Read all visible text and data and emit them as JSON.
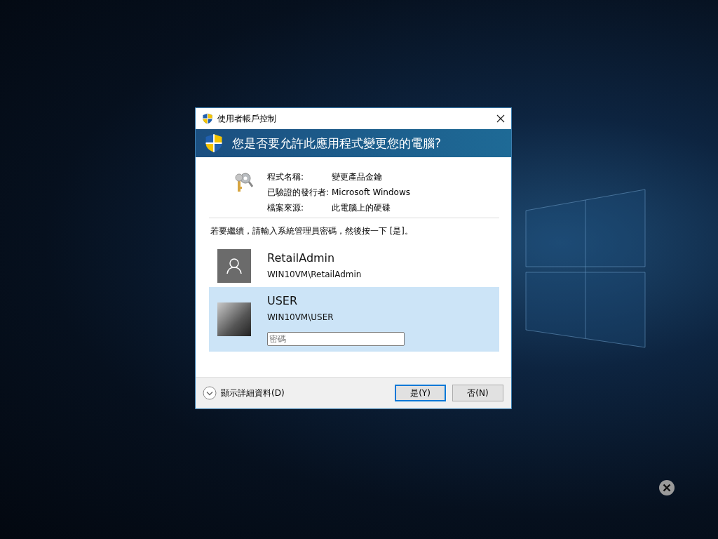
{
  "window": {
    "title": "使用者帳戶控制"
  },
  "header": {
    "question": "您是否要允許此應用程式變更您的電腦?"
  },
  "details": [
    {
      "label": "程式名稱:",
      "value": "變更產品金鑰"
    },
    {
      "label": "已驗證的發行者:",
      "value": "Microsoft Windows"
    },
    {
      "label": "檔案來源:",
      "value": "此電腦上的硬碟"
    }
  ],
  "instruction": "若要繼續，請輸入系統管理員密碼，然後按一下 [是]。",
  "accounts": [
    {
      "name": "RetailAdmin",
      "account": "WIN10VM\\RetailAdmin",
      "kind": "generic",
      "selected": false
    },
    {
      "name": "USER",
      "account": "WIN10VM\\USER",
      "kind": "photo",
      "selected": true,
      "password": {
        "placeholder": "密碼"
      }
    }
  ],
  "footer": {
    "details_link": "顯示詳細資料(D)",
    "buttons": [
      {
        "label": "是(Y)",
        "default": true
      },
      {
        "label": "否(N)",
        "default": false
      }
    ]
  }
}
